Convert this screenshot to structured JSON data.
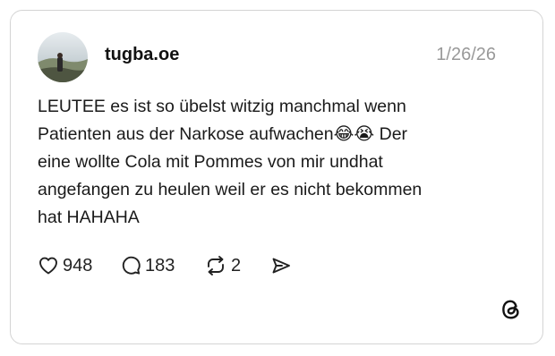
{
  "post": {
    "username": "tugba.oe",
    "date": "1/26/26",
    "text": "LEUTEE es ist so übelst witzig manchmal wenn\nPatienten aus der Narkose aufwachen😂😭 Der\neine wollte Cola mit Pommes von mir undhat\nangefangen zu heulen weil er es nicht bekommen\nhat HAHAHA"
  },
  "actions": {
    "likes": "948",
    "replies": "183",
    "reposts": "2"
  },
  "icons": {
    "like": "heart-icon",
    "reply": "speech-bubble-icon",
    "repost": "repost-arrows-icon",
    "share": "send-icon",
    "brand": "threads-logo-icon"
  },
  "colors": {
    "text": "#1a1a1a",
    "muted": "#999999",
    "border": "#d4d4d4"
  }
}
